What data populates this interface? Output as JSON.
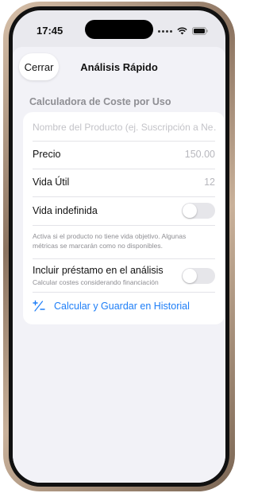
{
  "status_bar": {
    "time": "17:45"
  },
  "nav": {
    "close_label": "Cerrar",
    "title": "Análisis Rápido"
  },
  "section": {
    "header": "Calculadora de Coste por Uso"
  },
  "form": {
    "product_name_placeholder": "Nombre del Producto (ej. Suscripción a Ne…",
    "price_label": "Precio",
    "price_value": "150.00",
    "lifespan_label": "Vida Útil",
    "lifespan_value": "12",
    "indefinite_label": "Vida indefinida",
    "indefinite_enabled": false,
    "indefinite_footnote": "Activa si el producto no tiene vida objetivo. Algunas métricas se marcarán como no disponibles.",
    "loan_label": "Incluir préstamo en el análisis",
    "loan_sublabel": "Calcular costes considerando financiación",
    "loan_enabled": false,
    "calculate_label": "Calcular y Guardar en Historial"
  },
  "colors": {
    "accent": "#1e7ef7",
    "background": "#f2f2f7",
    "toggle_off": "#e6e6ea"
  },
  "icons": [
    "signal-icon",
    "wifi-icon",
    "battery-icon",
    "calculate-icon"
  ]
}
